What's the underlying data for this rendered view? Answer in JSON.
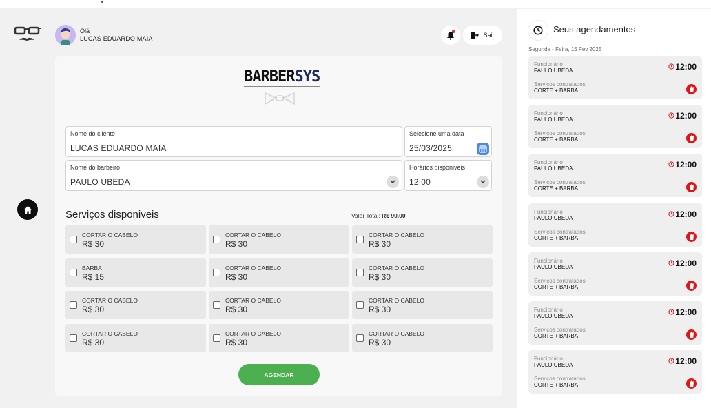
{
  "header": {
    "greeting": "Olá",
    "user_name": "LUCAS EDUARDO MAIA",
    "exit_label": "Sair"
  },
  "brand": {
    "part1": "BARBER",
    "part2": "SYS"
  },
  "form": {
    "client": {
      "label": "Nome do cliente",
      "value": "LUCAS EDUARDO MAIA"
    },
    "date": {
      "label": "Selecione uma data",
      "value": "25/03/2025"
    },
    "barber": {
      "label": "Nome do barbeiro",
      "value": "PAULO UBEDA"
    },
    "hours": {
      "label": "Horários disponiveis",
      "value": "12:00"
    }
  },
  "services": {
    "title": "Serviços disponiveis",
    "total_label": "Valor Total:",
    "total_value": "R$ 90,00",
    "items": [
      {
        "name": "CORTAR O CABELO",
        "price": "R$ 30"
      },
      {
        "name": "CORTAR O CABELO",
        "price": "R$ 30"
      },
      {
        "name": "CORTAR O CABELO",
        "price": "R$ 30"
      },
      {
        "name": "BARBA",
        "price": "R$ 15"
      },
      {
        "name": "CORTAR O CABELO",
        "price": "R$ 30"
      },
      {
        "name": "CORTAR O CABELO",
        "price": "R$ 30"
      },
      {
        "name": "CORTAR O CABELO",
        "price": "R$ 30"
      },
      {
        "name": "CORTAR O CABELO",
        "price": "R$ 30"
      },
      {
        "name": "CORTAR O CABELO",
        "price": "R$ 30"
      },
      {
        "name": "CORTAR O CABELO",
        "price": "R$ 30"
      },
      {
        "name": "CORTAR O CABELO",
        "price": "R$ 30"
      },
      {
        "name": "CORTAR O CABELO",
        "price": "R$ 30"
      }
    ]
  },
  "book_label": "AGENDAR",
  "panel": {
    "title": "Seus agendamentos",
    "date": "Segunda - Feira, 15 Fev 2025",
    "appointments": [
      {
        "staff_label": "Funcionário",
        "staff": "PAULO UBEDA",
        "services_label": "Serviços contratados",
        "services": "CORTE + BARBA",
        "time": "12:00"
      },
      {
        "staff_label": "Funcionário",
        "staff": "PAULO UBEDA",
        "services_label": "Serviços contratados",
        "services": "CORTE + BARBA",
        "time": "12:00"
      },
      {
        "staff_label": "Funcionário",
        "staff": "PAULO UBEDA",
        "services_label": "Serviços contratados",
        "services": "CORTE + BARBA",
        "time": "12:00"
      },
      {
        "staff_label": "Funcionário",
        "staff": "PAULO UBEDA",
        "services_label": "Serviços contratados",
        "services": "CORTE + BARBA",
        "time": "12:00"
      },
      {
        "staff_label": "Funcionário",
        "staff": "PAULO UBEDA",
        "services_label": "Serviços contratados",
        "services": "CORTE + BARBA",
        "time": "12:00"
      },
      {
        "staff_label": "Funcionário",
        "staff": "PAULO UBEDA",
        "services_label": "Serviços contratados",
        "services": "CORTE + BARBA",
        "time": "12:00"
      },
      {
        "staff_label": "Funcionário",
        "staff": "PAULO UBEDA",
        "services_label": "Serviços contratados",
        "services": "CORTE + BARBA",
        "time": "12:00"
      }
    ]
  },
  "colors": {
    "book_button": "#4caf50",
    "delete": "#e01515",
    "calendar": "#4a88ef",
    "brand_accent": "#1f2a5c"
  },
  "icons": [
    "glasses-mustache-logo-icon",
    "home-icon",
    "bell-icon",
    "exit-door-icon",
    "calendar-icon",
    "chevron-down-icon",
    "clock-icon",
    "timer-icon",
    "trash-icon"
  ]
}
